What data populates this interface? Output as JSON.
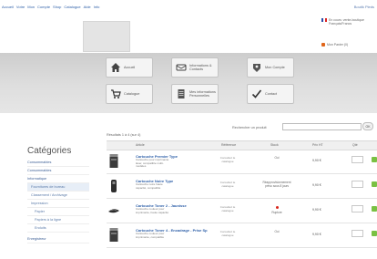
{
  "topbar": {
    "nav": [
      "Accueil",
      "Votre",
      "Mon",
      "Compte",
      "Shop",
      "Catalogue",
      "Aide",
      "Info"
    ],
    "account": "Boutik Pieds"
  },
  "header": {
    "logo_text": "",
    "lang_text": "En cours: vente-boutique",
    "lang_sub": "Français/Francs",
    "cart_text": "Mon Panier (0)"
  },
  "menu": {
    "tiles": [
      {
        "label": "Accueil",
        "icon": "home-icon"
      },
      {
        "label": "Informations & Contacts",
        "icon": "contact-card-icon"
      },
      {
        "label": "Mon Compte",
        "icon": "account-badge-icon"
      },
      {
        "label": "Catalogue",
        "icon": "cart-icon"
      },
      {
        "label": "Mes informations Personnelles",
        "icon": "document-icon"
      },
      {
        "label": "Contact",
        "icon": "checkmark-icon"
      }
    ]
  },
  "sidebar": {
    "title": "Catégories",
    "items": [
      {
        "label": "Consommables",
        "level": 0
      },
      {
        "label": "Consommables",
        "level": 0
      },
      {
        "label": "Informatique",
        "level": 0
      },
      {
        "label": "Fournitures de bureau",
        "level": 1,
        "selected": true
      },
      {
        "label": "Classement / Archivage",
        "level": 1
      },
      {
        "label": "Impression",
        "level": 1
      },
      {
        "label": "Papier",
        "level": 2
      },
      {
        "label": "Papiers à la ligne",
        "level": 2
      },
      {
        "label": "Enduits",
        "level": 2
      },
      {
        "label": "Enregistreur",
        "level": 0
      }
    ]
  },
  "listing": {
    "showing": "Résultats 1 à 4 (sur 4)",
    "search_label": "Rechercher un produit",
    "search_placeholder": "",
    "search_button": "OK",
    "headers": [
      "Article",
      "Référence",
      "Stock",
      "Prix HT",
      "Qté",
      ""
    ],
    "rows": [
      {
        "name": "Cartouche Premier Type",
        "desc": "Cartouche pour imprimante laser, compatible multi-modèles",
        "ref": "Consultez le catalogue",
        "stock": "Oui",
        "stock_dot": false,
        "price": "9,90 €",
        "thumb": "printer-cartridge-image"
      },
      {
        "name": "Cartouche Noire Type",
        "desc": "Cartouche noire haute capacité, compatible",
        "ref": "Consultez le catalogue",
        "stock": "Réapprovisionnement prévu sous 8 jours",
        "stock_dot": false,
        "price": "9,90 €",
        "thumb": "toner-image"
      },
      {
        "name": "Cartouche Toner 2 - Jaunisse",
        "desc": "Cartouche couleur pour imprimante, haute capacité",
        "ref": "Consultez le catalogue",
        "stock": "Rupture",
        "stock_dot": true,
        "price": "9,90 €",
        "thumb": "mouse-image"
      },
      {
        "name": "Cartouche Toner 4 - Encadrage - Prise Sp",
        "desc": "Cartouche couleur pour imprimante, compatible",
        "ref": "Consultez le catalogue",
        "stock": "Oui",
        "stock_dot": false,
        "price": "9,90 €",
        "thumb": "printer-cartridge-image"
      }
    ]
  },
  "colors": {
    "accent_blue": "#2d5fa8",
    "buy_green": "#7ac043",
    "alert_red": "#d9261c"
  }
}
